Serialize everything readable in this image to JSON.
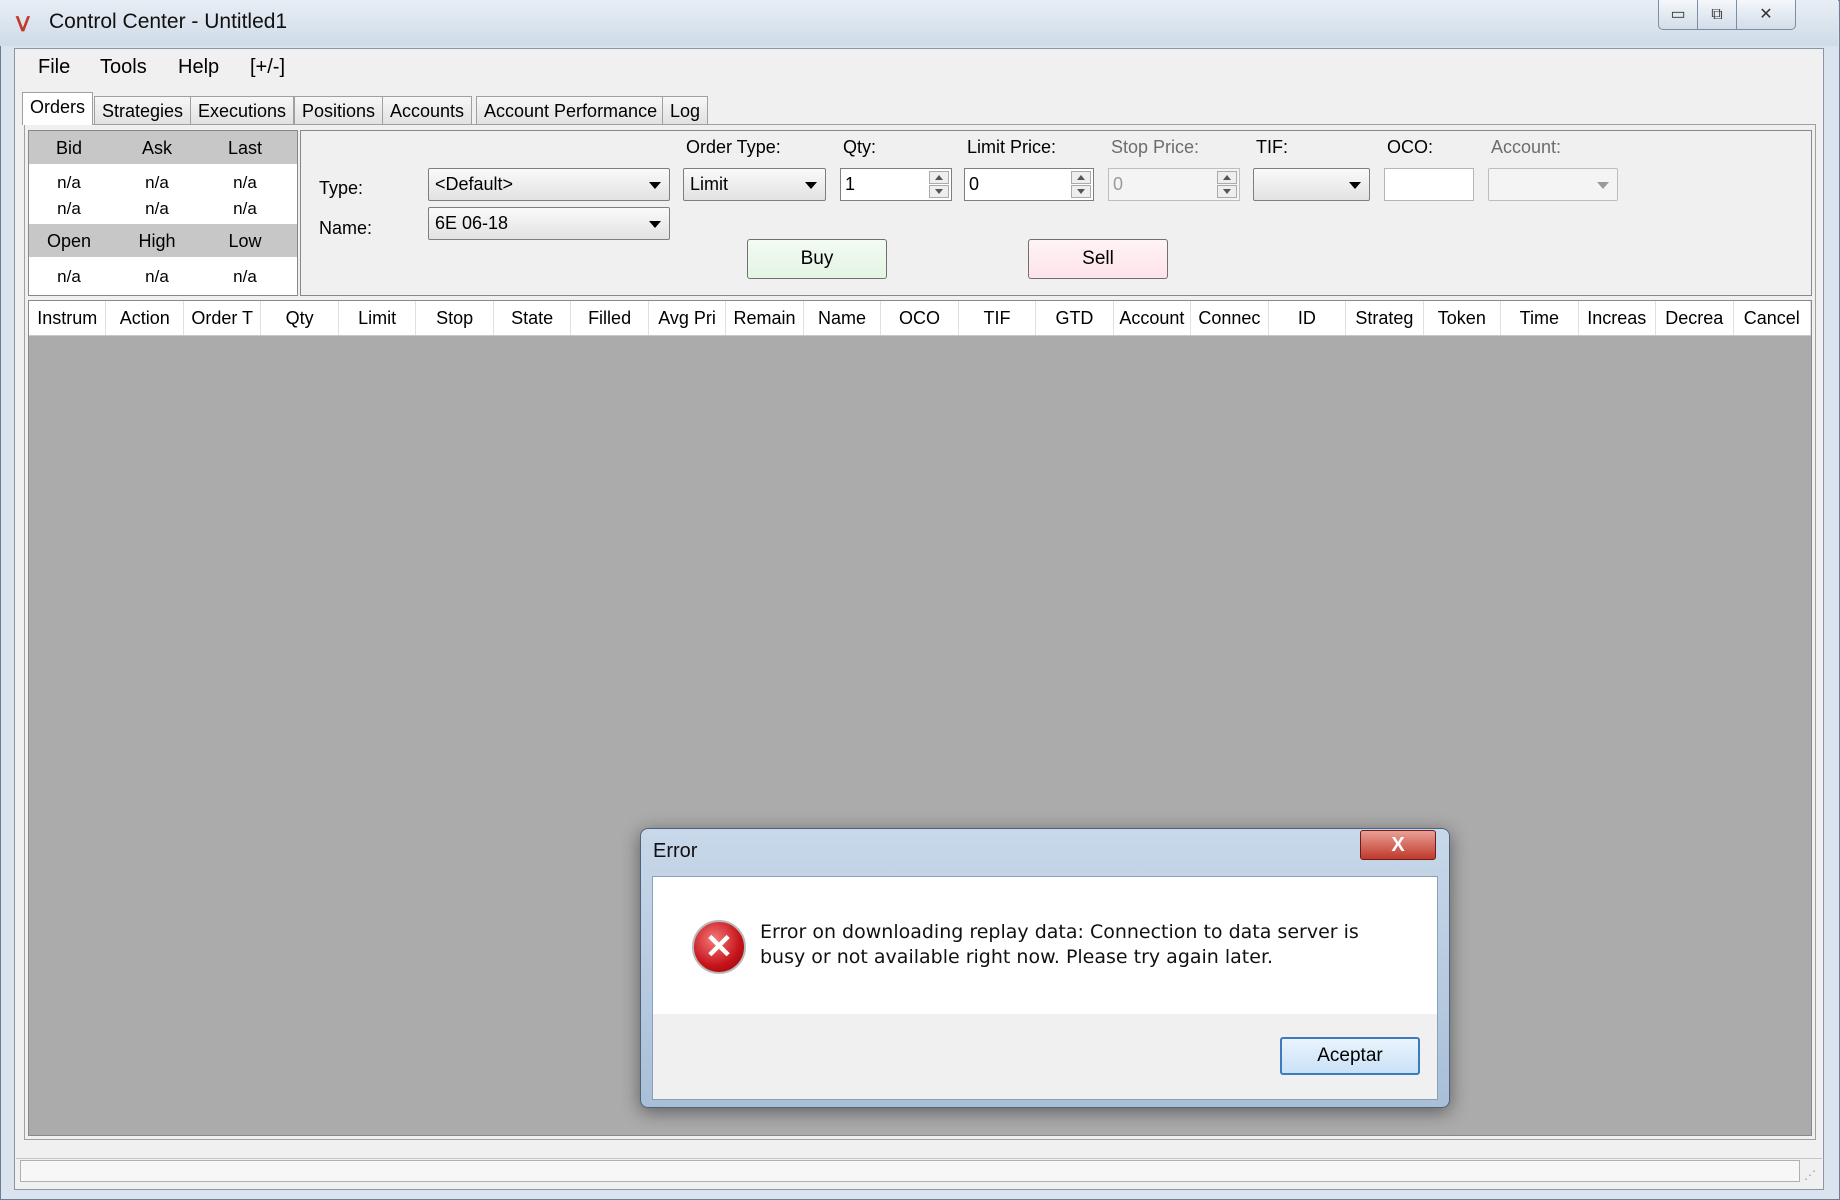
{
  "window": {
    "title": "Control Center - Untitled1",
    "min_glyph": "▭",
    "max_glyph": "⧉",
    "close_glyph": "✕",
    "logo_icon": "ninja-logo-icon"
  },
  "menu": [
    "File",
    "Tools",
    "Help",
    "[+/-]"
  ],
  "tabs": [
    "Orders",
    "Strategies",
    "Executions",
    "Positions",
    "Accounts",
    "Account Performance",
    "Log"
  ],
  "quote": {
    "headers_top": [
      "Bid",
      "Ask",
      "Last"
    ],
    "row1": [
      "n/a",
      "n/a",
      "n/a"
    ],
    "row2": [
      "n/a",
      "n/a",
      "n/a"
    ],
    "headers_bottom": [
      "Open",
      "High",
      "Low"
    ],
    "row3": [
      "n/a",
      "n/a",
      "n/a"
    ]
  },
  "order_form": {
    "type_label": "Type:",
    "type_value": "<Default>",
    "name_label": "Name:",
    "name_value": "6E 06-18",
    "order_type_label": "Order Type:",
    "order_type_value": "Limit",
    "qty_label": "Qty:",
    "qty_value": "1",
    "limit_price_label": "Limit Price:",
    "limit_price_value": "0",
    "stop_price_label": "Stop Price:",
    "stop_price_value": "0",
    "tif_label": "TIF:",
    "tif_value": "",
    "oco_label": "OCO:",
    "oco_value": "",
    "account_label": "Account:",
    "account_value": "",
    "buy_label": "Buy",
    "sell_label": "Sell"
  },
  "grid_columns": [
    "Instrum",
    "Action",
    "Order T",
    "Qty",
    "Limit",
    "Stop",
    "State",
    "Filled",
    "Avg Pri",
    "Remain",
    "Name",
    "OCO",
    "TIF",
    "GTD",
    "Account",
    "Connec",
    "ID",
    "Strateg",
    "Token",
    "Time",
    "Increas",
    "Decrea",
    "Cancel"
  ],
  "dialog": {
    "title": "Error",
    "close_glyph": "X",
    "icon": "error-icon",
    "message": "Error on downloading replay data: Connection to data server is busy or not available right now. Please try again later.",
    "ok_label": "Aceptar"
  }
}
